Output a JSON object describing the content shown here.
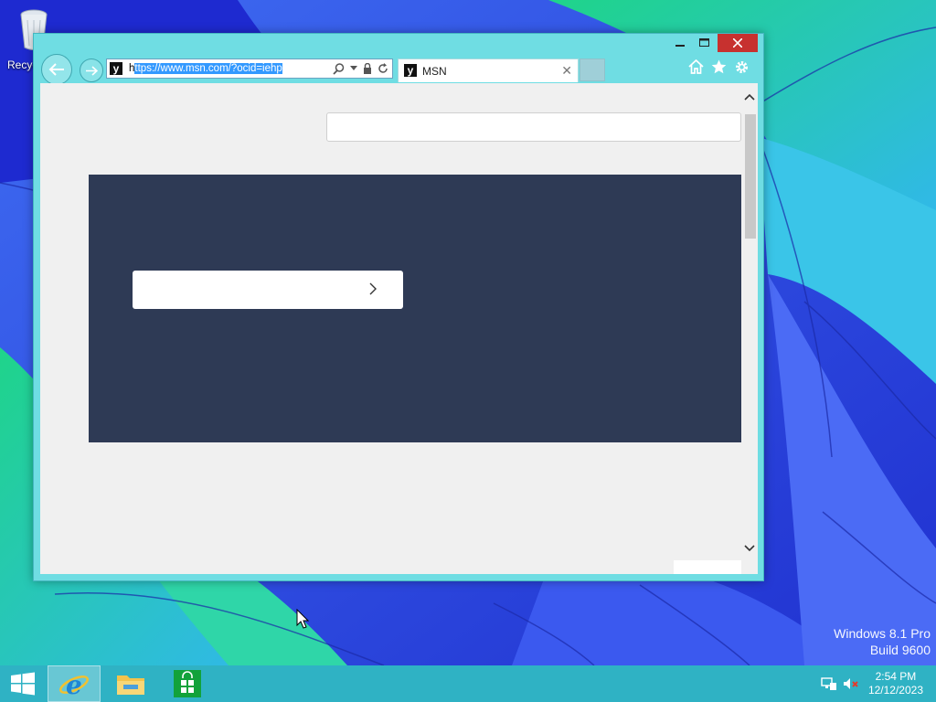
{
  "desktop": {
    "recycle_bin_label": "Recyc"
  },
  "browser": {
    "address": {
      "url_first_char": "h",
      "url_rest": "ttps://www.msn.com/?ocid=iehp"
    },
    "tab": {
      "title": "MSN"
    },
    "colors": {
      "frame": "#6fdde3",
      "close_button": "#c7312f",
      "hero_panel": "#2e3a55"
    }
  },
  "os_watermark": {
    "line1": "Windows 8.1 Pro",
    "line2": "Build 9600"
  },
  "clock": {
    "time": "2:54 PM",
    "date": "12/12/2023"
  },
  "taskbar": {
    "items": [
      "start-icon",
      "internet-explorer-icon",
      "file-explorer-icon",
      "store-icon"
    ]
  }
}
